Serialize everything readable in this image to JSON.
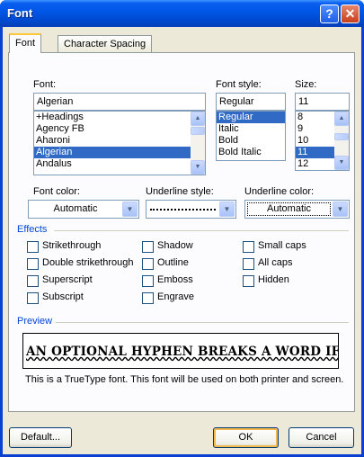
{
  "window": {
    "title": "Font",
    "help_glyph": "?",
    "close_glyph": "✕"
  },
  "tabs": [
    {
      "label": "Font",
      "active": true
    },
    {
      "label": "Character Spacing",
      "active": false
    }
  ],
  "font": {
    "label": "Font:",
    "value": "Algerian",
    "items": [
      "+Headings",
      "Agency FB",
      "Aharoni",
      "Algerian",
      "Andalus"
    ],
    "selected": "Algerian"
  },
  "font_style": {
    "label": "Font style:",
    "value": "Regular",
    "items": [
      "Regular",
      "Italic",
      "Bold",
      "Bold Italic"
    ],
    "selected": "Regular"
  },
  "size": {
    "label": "Size:",
    "value": "11",
    "items": [
      "8",
      "9",
      "10",
      "11",
      "12"
    ],
    "selected": "11"
  },
  "font_color": {
    "label": "Font color:",
    "value": "Automatic"
  },
  "underline_style": {
    "label": "Underline style:"
  },
  "underline_color": {
    "label": "Underline color:",
    "value": "Automatic"
  },
  "effects": {
    "title": "Effects",
    "checkboxes": [
      {
        "label": "Strikethrough",
        "checked": false
      },
      {
        "label": "Double strikethrough",
        "checked": false
      },
      {
        "label": "Superscript",
        "checked": false
      },
      {
        "label": "Subscript",
        "checked": false
      },
      {
        "label": "Shadow",
        "checked": false
      },
      {
        "label": "Outline",
        "checked": false
      },
      {
        "label": "Emboss",
        "checked": false
      },
      {
        "label": "Engrave",
        "checked": false
      },
      {
        "label": "Small caps",
        "checked": false
      },
      {
        "label": "All caps",
        "checked": false
      },
      {
        "label": "Hidden",
        "checked": false
      }
    ]
  },
  "preview": {
    "title": "Preview",
    "sample": "AN OPTIONAL HYPHEN BREAKS A WORD IF IT FALLS",
    "note": "This is a TrueType font. This font will be used on both printer and screen."
  },
  "buttons": {
    "default": "Default...",
    "ok": "OK",
    "cancel": "Cancel"
  },
  "icons": {
    "scroll_up": "▲",
    "scroll_down": "▼",
    "dropdown": "▼"
  },
  "colors": {
    "title_bar": "#0055e5",
    "section_title": "#0046d5",
    "selection": "#316ac5",
    "dialog_bg": "#ece9d8"
  }
}
